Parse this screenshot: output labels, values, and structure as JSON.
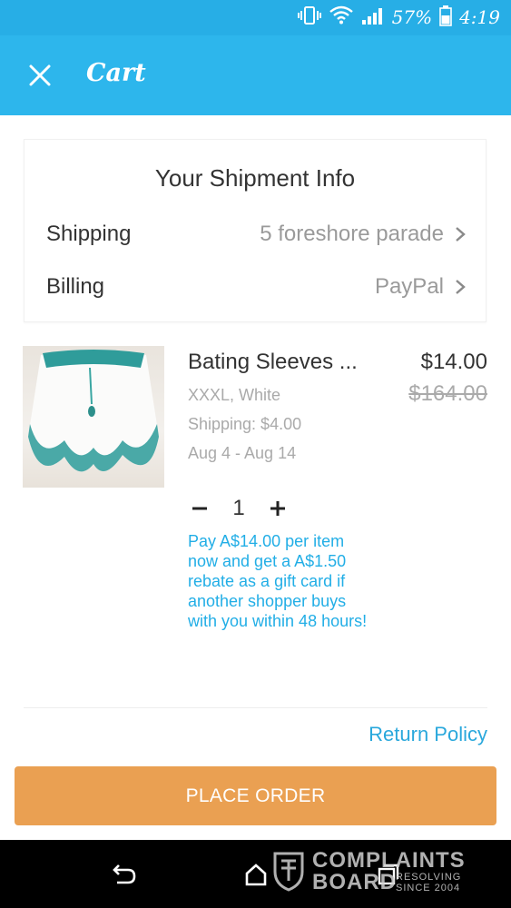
{
  "status_bar": {
    "battery": "57%",
    "time": "4:19",
    "icons": [
      "vibrate-icon",
      "wifi-icon",
      "signal-icon",
      "battery-icon"
    ]
  },
  "app_bar": {
    "title": "Cart",
    "close_icon": "close-icon",
    "background": "#2db6ec"
  },
  "shipment": {
    "title": "Your Shipment Info",
    "rows": [
      {
        "label": "Shipping",
        "value": "5 foreshore parade"
      },
      {
        "label": "Billing",
        "value": "PayPal"
      }
    ]
  },
  "product": {
    "name": "Bating Sleeves ...",
    "price": "$14.00",
    "original_price": "$164.00",
    "variant": "XXXL, White",
    "shipping": "Shipping: $4.00",
    "delivery": "Aug 4 - Aug 14",
    "quantity": "1",
    "rebate_text": "Pay A$14.00 per item now and get a A$1.50 rebate as a gift card if another shopper buys with you within 48 hours!",
    "accent": "#22aee6"
  },
  "footer": {
    "return_policy": "Return Policy",
    "place_order": "PLACE ORDER",
    "place_order_color": "#eaa052"
  },
  "watermark": {
    "line1": "COMPLAINTS",
    "line2": "BOARD",
    "small1": "RESOLVING",
    "small2": "SINCE 2004"
  }
}
